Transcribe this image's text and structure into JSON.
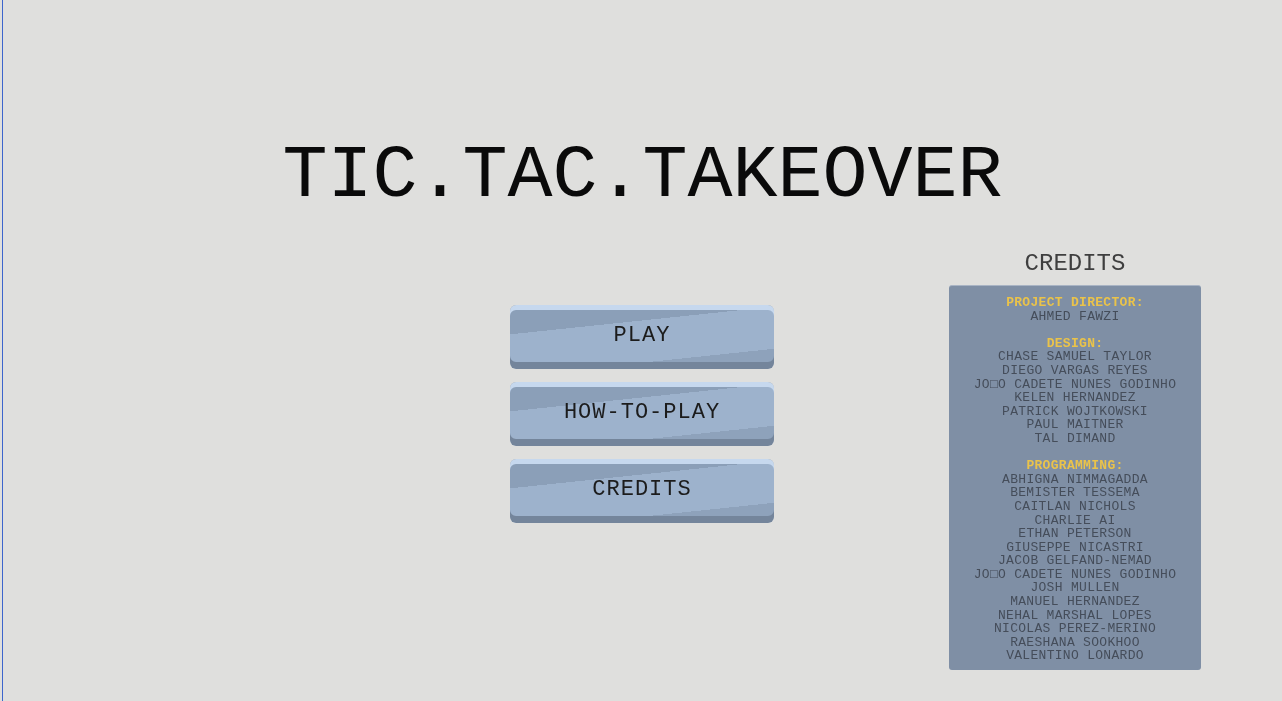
{
  "title": "TIC.TAC.TAKEOVER",
  "menu": [
    {
      "label": "PLAY"
    },
    {
      "label": "HOW-TO-PLAY"
    },
    {
      "label": "CREDITS"
    }
  ],
  "credits": {
    "heading": "CREDITS",
    "sections": [
      {
        "role": "PROJECT DIRECTOR:",
        "names": [
          "AHMED FAWZI"
        ]
      },
      {
        "role": "DESIGN:",
        "names": [
          "CHASE SAMUEL TAYLOR",
          "DIEGO VARGAS REYES",
          "JO□O CADETE NUNES GODINHO",
          "KELEN HERNANDEZ",
          "PATRICK WOJTKOWSKI",
          "PAUL MAITNER",
          "TAL DIMAND"
        ]
      },
      {
        "role": "PROGRAMMING:",
        "names": [
          "ABHIGNA NIMMAGADDA",
          "BEMISTER TESSEMA",
          "CAITLAN NICHOLS",
          "CHARLIE AI",
          "ETHAN PETERSON",
          "GIUSEPPE NICASTRI",
          "JACOB GELFAND-NEMAD",
          "JO□O CADETE NUNES GODINHO",
          "JOSH MULLEN",
          "MANUEL HERNANDEZ",
          "NEHAL MARSHAL LOPES",
          "NICOLAS PEREZ-MERINO",
          "RAESHANA SOOKHOO",
          "VALENTINO LONARDO"
        ]
      }
    ]
  }
}
